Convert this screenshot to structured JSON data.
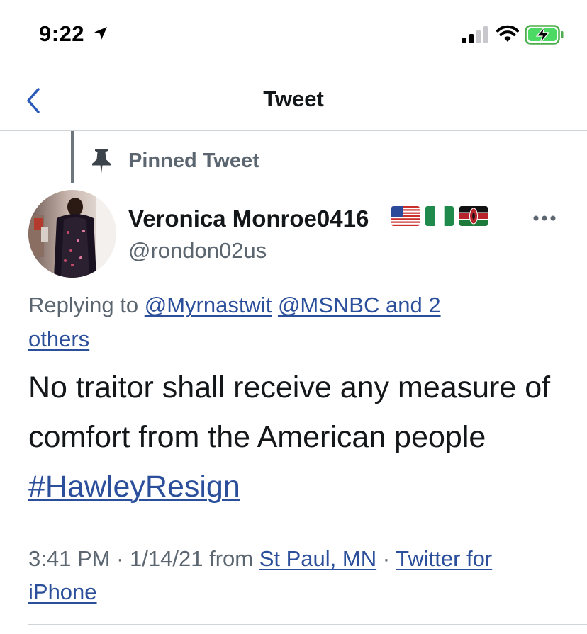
{
  "status_bar": {
    "time": "9:22",
    "icons": [
      "location-arrow-icon",
      "cellular-signal-icon",
      "wifi-icon",
      "battery-charging-icon"
    ]
  },
  "header": {
    "back_icon": "chevron-left-icon",
    "title": "Tweet"
  },
  "pinned": {
    "icon": "pin-icon",
    "label": "Pinned Tweet"
  },
  "author": {
    "display_name": "Veronica Monroe0416",
    "flags": [
      "flag-us-icon",
      "flag-nigeria-icon",
      "flag-kenya-icon"
    ],
    "handle": "@rondon02us",
    "more_icon": "more-horizontal-icon"
  },
  "reply": {
    "prefix": "Replying to",
    "mention_1": "@Myrnastwit",
    "mention_2": "@MSNBC and 2",
    "mention_2_cont": "others"
  },
  "tweet": {
    "text": "No traitor shall receive any measure of comfort from the American people",
    "hashtag": "#HawleyResign"
  },
  "meta": {
    "time": "3:41 PM",
    "sep1": "·",
    "date": "1/14/21",
    "from": "from",
    "location": "St Paul, MN",
    "sep2": "·",
    "source": "Twitter for",
    "source_cont": "iPhone"
  },
  "colors": {
    "link": "#2b4f9b",
    "muted": "#5b6670",
    "text": "#14171a",
    "divider": "#cfd4d9"
  }
}
